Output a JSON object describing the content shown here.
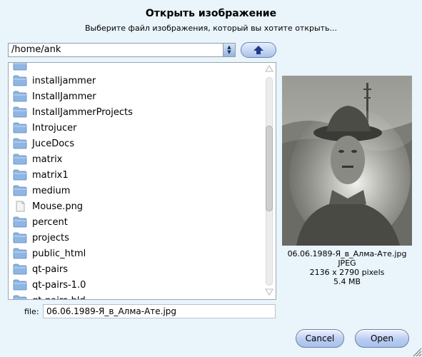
{
  "dialog": {
    "title": "Открыть изображение",
    "subtitle": "Выберите файл изображения, который вы хотите открыть..."
  },
  "path_combo": {
    "value": "/home/ank"
  },
  "up_button": {
    "icon": "arrow-up-icon"
  },
  "file_list": [
    {
      "name": "",
      "type": "folder"
    },
    {
      "name": "installjammer",
      "type": "folder"
    },
    {
      "name": "InstallJammer",
      "type": "folder"
    },
    {
      "name": "InstallJammerProjects",
      "type": "folder"
    },
    {
      "name": "Introjucer",
      "type": "folder"
    },
    {
      "name": "JuceDocs",
      "type": "folder"
    },
    {
      "name": "matrix",
      "type": "folder"
    },
    {
      "name": "matrix1",
      "type": "folder"
    },
    {
      "name": "medium",
      "type": "folder"
    },
    {
      "name": "Mouse.png",
      "type": "file"
    },
    {
      "name": "percent",
      "type": "folder"
    },
    {
      "name": "projects",
      "type": "folder"
    },
    {
      "name": "public_html",
      "type": "folder"
    },
    {
      "name": "qt-pairs",
      "type": "folder"
    },
    {
      "name": "qt-pairs-1.0",
      "type": "folder"
    },
    {
      "name": "qt-pairs-bld",
      "type": "folder"
    }
  ],
  "preview": {
    "filename": "06.06.1989-Я_в_Алма-Ате.jpg",
    "format": "JPEG",
    "dimensions": "2136 x 2790 pixels",
    "size": "5.4 MB"
  },
  "file_field": {
    "label": "file:",
    "value": "06.06.1989-Я_в_Алма-Ате.jpg"
  },
  "buttons": {
    "cancel": "Cancel",
    "open": "Open"
  },
  "colors": {
    "background": "#e9f4fb",
    "folder_blue": "#8fb6e3",
    "button_gradient_bottom": "#a8c1ec"
  }
}
